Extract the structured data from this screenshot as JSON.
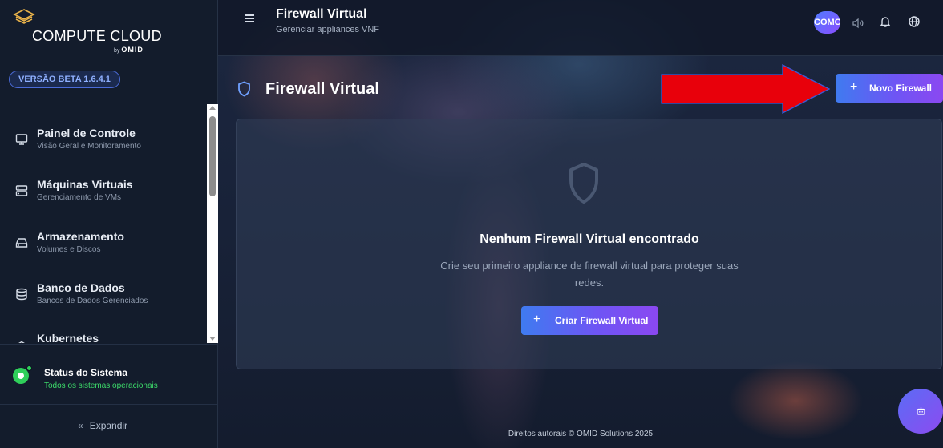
{
  "brand": {
    "title": "COMPUTE CLOUD",
    "by": "by",
    "company": "OMID",
    "version": "VERSÃO BETA 1.6.4.1"
  },
  "sidebar": {
    "items": [
      {
        "title": "Painel de Controle",
        "subtitle": "Visão Geral e Monitoramento",
        "icon": "monitor-icon"
      },
      {
        "title": "Máquinas Virtuais",
        "subtitle": "Gerenciamento de VMs",
        "icon": "server-icon"
      },
      {
        "title": "Armazenamento",
        "subtitle": "Volumes e Discos",
        "icon": "hard-drive-icon"
      },
      {
        "title": "Banco de Dados",
        "subtitle": "Bancos de Dados Gerenciados",
        "icon": "database-icon"
      },
      {
        "title": "Kubernetes",
        "subtitle": "",
        "icon": "kubernetes-icon"
      }
    ],
    "status": {
      "title": "Status do Sistema",
      "subtitle": "Todos os sistemas operacionais",
      "color": "#2fcf5a"
    },
    "expand": {
      "arrow": "«",
      "label": "Expandir"
    }
  },
  "topbar": {
    "title": "Firewall Virtual",
    "subtitle": "Gerenciar appliances VNF",
    "avatar": "COMO"
  },
  "page": {
    "title": "Firewall Virtual",
    "new_button": "Novo Firewall",
    "plus": "+"
  },
  "empty_state": {
    "title": "Nenhum Firewall Virtual encontrado",
    "description": "Crie seu primeiro appliance de firewall virtual para proteger suas redes.",
    "button": "Criar Firewall Virtual"
  },
  "footer": {
    "text": "Direitos autorais © OMID Solutions 2025"
  },
  "colors": {
    "accent_start": "#3f7bf0",
    "accent_end": "#8b48f1",
    "annotation_arrow": "#e8000b",
    "status_green": "#2fcf5a"
  }
}
